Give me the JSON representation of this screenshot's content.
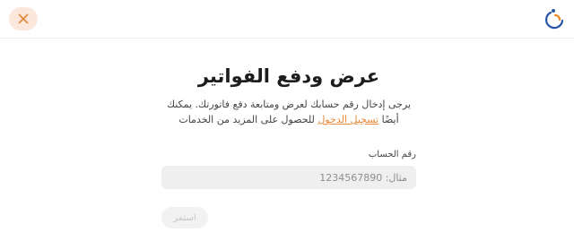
{
  "header": {
    "close_icon": "close-x-icon",
    "logo_icon": "brand-logo-icon",
    "accent_color": "#e58a3c"
  },
  "main": {
    "title": "عرض ودفع الفواتير",
    "description_line1": "يرجى إدخال رقم حسابك لعرض ومتابعة دفع فاتورتك. يمكنك",
    "description_line2_prefix": "أيضًا",
    "description_link": "تسجيل الدخول",
    "description_line2_suffix": "للحصول على المزيد من الخدمات"
  },
  "form": {
    "account_label": "رقم الحساب",
    "account_placeholder": "مثال: 1234567890",
    "account_value": "",
    "continue_label": "استمر"
  }
}
